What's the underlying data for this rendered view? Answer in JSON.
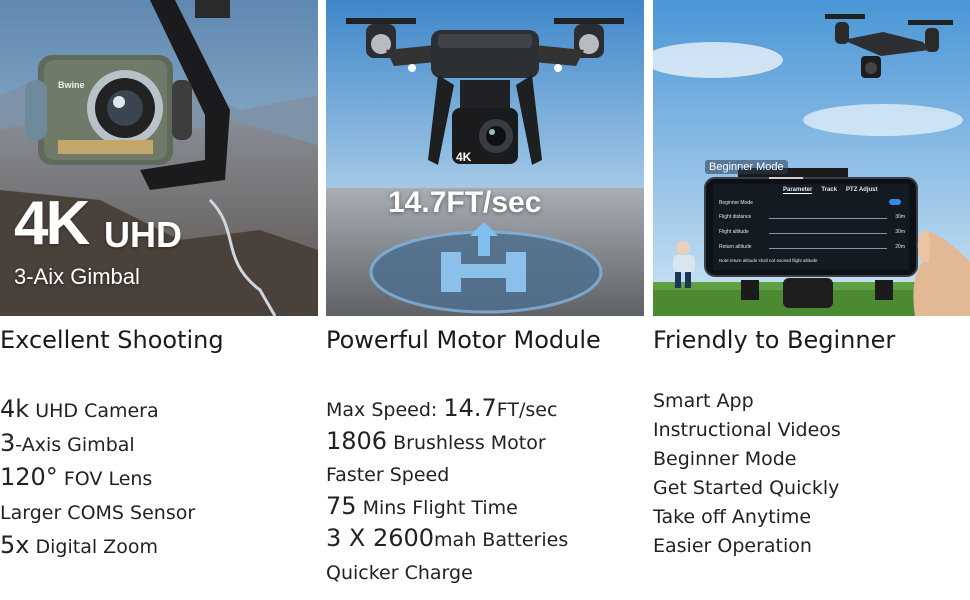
{
  "panels": [
    {
      "overlay_big": "4K",
      "overlay_uhd": "UHD",
      "overlay_sub": "3-Aix Gimbal",
      "camera_brand": "Bwine",
      "heading": "Excellent Shooting",
      "features": [
        {
          "big": "4k",
          "text": " UHD Camera"
        },
        {
          "big": "3",
          "text": "-Axis Gimbal"
        },
        {
          "big": "120°",
          "text": " FOV Lens"
        },
        {
          "big": "",
          "text": "Larger COMS Sensor"
        },
        {
          "big": "5x",
          "text": " Digital Zoom"
        }
      ]
    },
    {
      "overlay_speed": "14.7FT/sec",
      "camera_badge": "4K",
      "heading": "Powerful Motor Module",
      "features": [
        {
          "pre": "Max Speed: ",
          "big": "14.7",
          "text": "FT/sec"
        },
        {
          "pre": "",
          "big": "1806",
          "text": " Brushless Motor"
        },
        {
          "pre": "",
          "big": "",
          "text": "Faster Speed"
        },
        {
          "pre": "",
          "big": "75",
          "text": " Mins Flight Time"
        },
        {
          "pre": "",
          "big": "3 X 2600",
          "text": "mah Batteries"
        },
        {
          "pre": "",
          "big": "",
          "text": "Quicker Charge"
        }
      ]
    },
    {
      "callout": "Beginner Mode",
      "phone": {
        "mode_label": "Beginner Mode",
        "tabs": [
          "Parameter",
          "Track",
          "PTZ Adjust"
        ],
        "rows": [
          {
            "label": "Flight distance",
            "value": "30m"
          },
          {
            "label": "Flight altitude",
            "value": "30m"
          },
          {
            "label": "Return altitude",
            "value": "20m"
          }
        ],
        "note": "Note:return altitude shall not exceed flight altitude"
      },
      "heading": "Friendly to Beginner",
      "features": [
        {
          "text": "Smart App"
        },
        {
          "text": "Instructional Videos"
        },
        {
          "text": "Beginner Mode"
        },
        {
          "text": "Get Started Quickly"
        },
        {
          "text": "Take off Anytime"
        },
        {
          "text": "Easier Operation"
        }
      ]
    }
  ]
}
